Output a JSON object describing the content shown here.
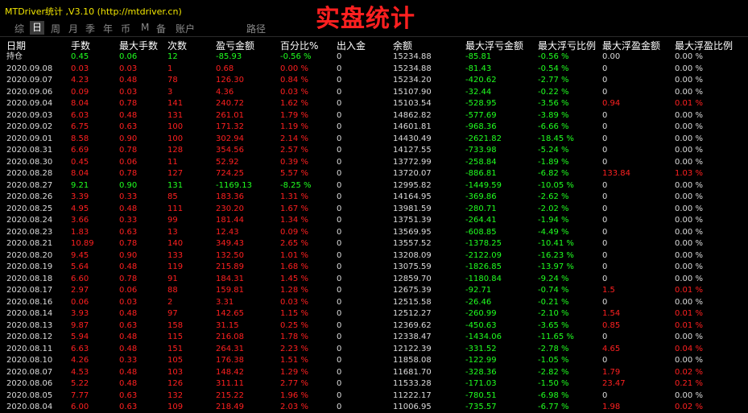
{
  "window": {
    "app_title": "MTDriver统计 ,V3.10 (http://mtdriver.cn)",
    "big_title": "实盘统计"
  },
  "tabs": [
    "综",
    "日",
    "周",
    "月",
    "季",
    "年",
    "币",
    "M",
    "备",
    "账户",
    "路径"
  ],
  "active_tab": 1,
  "colors": {
    "red": "#ff2020",
    "green": "#20ff20",
    "white": "#ffffff",
    "gray": "#dcdcdc",
    "yellow": "#f2e600"
  },
  "table": {
    "columns": [
      "日期",
      "手数",
      "最大手数",
      "次数",
      "盈亏金额",
      "百分比%",
      "出入金",
      "余额",
      "最大浮亏金额",
      "最大浮亏比例",
      "最大浮盈金额",
      "最大浮盈比例"
    ],
    "rows": [
      {
        "c": [
          "持仓",
          "0.45",
          "0.06",
          "12",
          "-85.93",
          "-0.56 %",
          "0",
          "15234.88",
          "-85.81",
          "-0.56 %",
          "0.00",
          "0.00 %"
        ],
        "s": "g"
      },
      {
        "c": [
          "2020.09.08",
          "0.03",
          "0.03",
          "1",
          "0.68",
          "0.00 %",
          "0",
          "15234.88",
          "-81.43",
          "-0.54 %",
          "0",
          "0.00 %"
        ],
        "s": "r"
      },
      {
        "c": [
          "2020.09.07",
          "4.23",
          "0.48",
          "78",
          "126.30",
          "0.84 %",
          "0",
          "15234.20",
          "-420.62",
          "-2.77 %",
          "0",
          "0.00 %"
        ],
        "s": "r"
      },
      {
        "c": [
          "2020.09.06",
          "0.09",
          "0.03",
          "3",
          "4.36",
          "0.03 %",
          "0",
          "15107.90",
          "-32.44",
          "-0.22 %",
          "0",
          "0.00 %"
        ],
        "s": "r"
      },
      {
        "c": [
          "2020.09.04",
          "8.04",
          "0.78",
          "141",
          "240.72",
          "1.62 %",
          "0",
          "15103.54",
          "-528.95",
          "-3.56 %",
          "0.94",
          "0.01 %"
        ],
        "s": "r",
        "p": true
      },
      {
        "c": [
          "2020.09.03",
          "6.03",
          "0.48",
          "131",
          "261.01",
          "1.79 %",
          "0",
          "14862.82",
          "-577.69",
          "-3.89 %",
          "0",
          "0.00 %"
        ],
        "s": "r"
      },
      {
        "c": [
          "2020.09.02",
          "6.75",
          "0.63",
          "100",
          "171.32",
          "1.19 %",
          "0",
          "14601.81",
          "-968.36",
          "-6.66 %",
          "0",
          "0.00 %"
        ],
        "s": "r"
      },
      {
        "c": [
          "2020.09.01",
          "8.58",
          "0.90",
          "100",
          "302.94",
          "2.14 %",
          "0",
          "14430.49",
          "-2621.82",
          "-18.45 %",
          "0",
          "0.00 %"
        ],
        "s": "r"
      },
      {
        "c": [
          "2020.08.31",
          "6.69",
          "0.78",
          "128",
          "354.56",
          "2.57 %",
          "0",
          "14127.55",
          "-733.98",
          "-5.24 %",
          "0",
          "0.00 %"
        ],
        "s": "r"
      },
      {
        "c": [
          "2020.08.30",
          "0.45",
          "0.06",
          "11",
          "52.92",
          "0.39 %",
          "0",
          "13772.99",
          "-258.84",
          "-1.89 %",
          "0",
          "0.00 %"
        ],
        "s": "r"
      },
      {
        "c": [
          "2020.08.28",
          "8.04",
          "0.78",
          "127",
          "724.25",
          "5.57 %",
          "0",
          "13720.07",
          "-886.81",
          "-6.82 %",
          "133.84",
          "1.03 %"
        ],
        "s": "r",
        "p": true
      },
      {
        "c": [
          "2020.08.27",
          "9.21",
          "0.90",
          "131",
          "-1169.13",
          "-8.25 %",
          "0",
          "12995.82",
          "-1449.59",
          "-10.05 %",
          "0",
          "0.00 %"
        ],
        "s": "g"
      },
      {
        "c": [
          "2020.08.26",
          "3.39",
          "0.33",
          "85",
          "183.36",
          "1.31 %",
          "0",
          "14164.95",
          "-369.86",
          "-2.62 %",
          "0",
          "0.00 %"
        ],
        "s": "r"
      },
      {
        "c": [
          "2020.08.25",
          "4.95",
          "0.48",
          "111",
          "230.20",
          "1.67 %",
          "0",
          "13981.59",
          "-280.71",
          "-2.02 %",
          "0",
          "0.00 %"
        ],
        "s": "r"
      },
      {
        "c": [
          "2020.08.24",
          "3.66",
          "0.33",
          "99",
          "181.44",
          "1.34 %",
          "0",
          "13751.39",
          "-264.41",
          "-1.94 %",
          "0",
          "0.00 %"
        ],
        "s": "r"
      },
      {
        "c": [
          "2020.08.23",
          "1.83",
          "0.63",
          "13",
          "12.43",
          "0.09 %",
          "0",
          "13569.95",
          "-608.85",
          "-4.49 %",
          "0",
          "0.00 %"
        ],
        "s": "r"
      },
      {
        "c": [
          "2020.08.21",
          "10.89",
          "0.78",
          "140",
          "349.43",
          "2.65 %",
          "0",
          "13557.52",
          "-1378.25",
          "-10.41 %",
          "0",
          "0.00 %"
        ],
        "s": "r"
      },
      {
        "c": [
          "2020.08.20",
          "9.45",
          "0.90",
          "133",
          "132.50",
          "1.01 %",
          "0",
          "13208.09",
          "-2122.09",
          "-16.23 %",
          "0",
          "0.00 %"
        ],
        "s": "r"
      },
      {
        "c": [
          "2020.08.19",
          "5.64",
          "0.48",
          "119",
          "215.89",
          "1.68 %",
          "0",
          "13075.59",
          "-1826.85",
          "-13.97 %",
          "0",
          "0.00 %"
        ],
        "s": "r"
      },
      {
        "c": [
          "2020.08.18",
          "6.60",
          "0.78",
          "91",
          "184.31",
          "1.45 %",
          "0",
          "12859.70",
          "-1180.84",
          "-9.24 %",
          "0",
          "0.00 %"
        ],
        "s": "r"
      },
      {
        "c": [
          "2020.08.17",
          "2.97",
          "0.06",
          "88",
          "159.81",
          "1.28 %",
          "0",
          "12675.39",
          "-92.71",
          "-0.74 %",
          "1.5",
          "0.01 %"
        ],
        "s": "r",
        "p": true
      },
      {
        "c": [
          "2020.08.16",
          "0.06",
          "0.03",
          "2",
          "3.31",
          "0.03 %",
          "0",
          "12515.58",
          "-26.46",
          "-0.21 %",
          "0",
          "0.00 %"
        ],
        "s": "r"
      },
      {
        "c": [
          "2020.08.14",
          "3.93",
          "0.48",
          "97",
          "142.65",
          "1.15 %",
          "0",
          "12512.27",
          "-260.99",
          "-2.10 %",
          "1.54",
          "0.01 %"
        ],
        "s": "r",
        "p": true
      },
      {
        "c": [
          "2020.08.13",
          "9.87",
          "0.63",
          "158",
          "31.15",
          "0.25 %",
          "0",
          "12369.62",
          "-450.63",
          "-3.65 %",
          "0.85",
          "0.01 %"
        ],
        "s": "r",
        "p": true
      },
      {
        "c": [
          "2020.08.12",
          "5.94",
          "0.48",
          "115",
          "216.08",
          "1.78 %",
          "0",
          "12338.47",
          "-1434.06",
          "-11.65 %",
          "0",
          "0.00 %"
        ],
        "s": "r"
      },
      {
        "c": [
          "2020.08.11",
          "6.63",
          "0.48",
          "151",
          "264.31",
          "2.23 %",
          "0",
          "12122.39",
          "-331.52",
          "-2.78 %",
          "4.65",
          "0.04 %"
        ],
        "s": "r",
        "p": true
      },
      {
        "c": [
          "2020.08.10",
          "4.26",
          "0.33",
          "105",
          "176.38",
          "1.51 %",
          "0",
          "11858.08",
          "-122.99",
          "-1.05 %",
          "0",
          "0.00 %"
        ],
        "s": "r"
      },
      {
        "c": [
          "2020.08.07",
          "4.53",
          "0.48",
          "103",
          "148.42",
          "1.29 %",
          "0",
          "11681.70",
          "-328.36",
          "-2.82 %",
          "1.79",
          "0.02 %"
        ],
        "s": "r",
        "p": true
      },
      {
        "c": [
          "2020.08.06",
          "5.22",
          "0.48",
          "126",
          "311.11",
          "2.77 %",
          "0",
          "11533.28",
          "-171.03",
          "-1.50 %",
          "23.47",
          "0.21 %"
        ],
        "s": "r",
        "p": true
      },
      {
        "c": [
          "2020.08.05",
          "7.77",
          "0.63",
          "132",
          "215.22",
          "1.96 %",
          "0",
          "11222.17",
          "-780.51",
          "-6.98 %",
          "0",
          "0.00 %"
        ],
        "s": "r"
      },
      {
        "c": [
          "2020.08.04",
          "6.00",
          "0.63",
          "109",
          "218.49",
          "2.03 %",
          "0",
          "11006.95",
          "-735.57",
          "-6.77 %",
          "1.98",
          "0.02 %"
        ],
        "s": "r",
        "p": true
      }
    ]
  }
}
